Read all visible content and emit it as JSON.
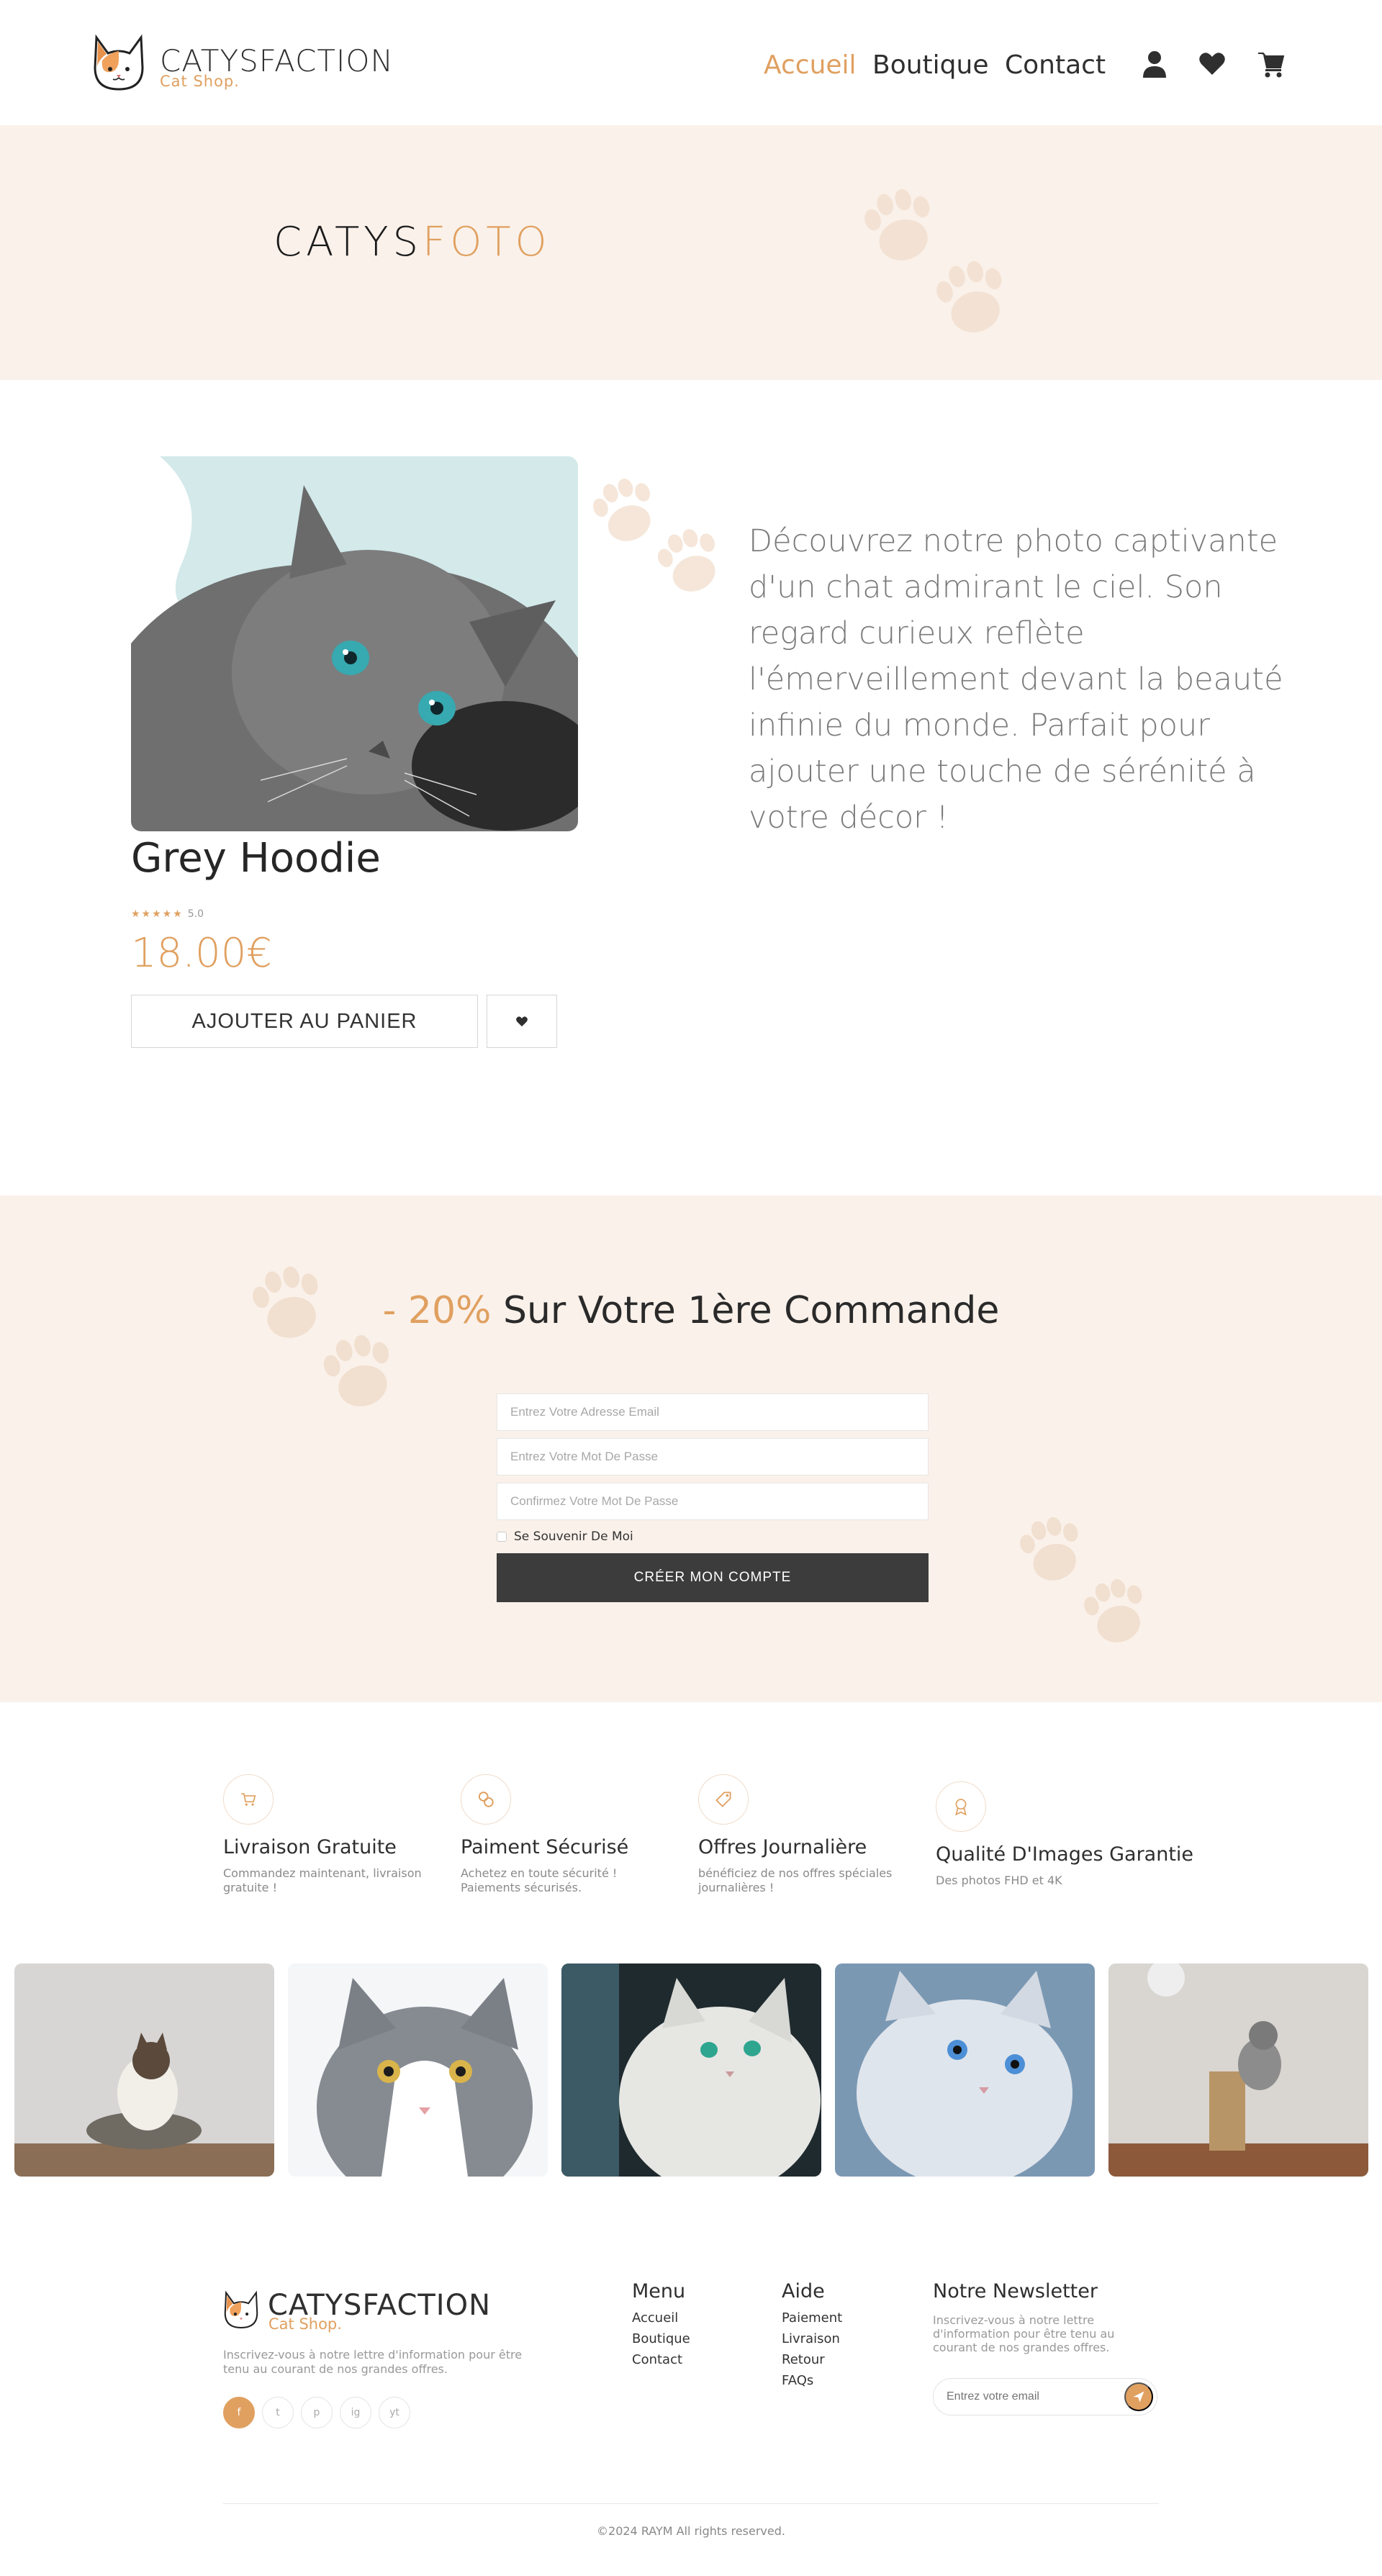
{
  "header": {
    "brand_name": "CATYSFACTION",
    "brand_sub": "Cat Shop.",
    "nav": [
      {
        "label": "Accueil",
        "active": true
      },
      {
        "label": "Boutique",
        "active": false
      },
      {
        "label": "Contact",
        "active": false
      }
    ],
    "icons": [
      "user-icon",
      "heart-icon",
      "cart-icon"
    ]
  },
  "banner": {
    "title_main": "CATYS",
    "title_accent": "FOTO"
  },
  "product": {
    "name": "Grey Hoodie",
    "stars": "★★★★★",
    "rating": "5.0",
    "price": "18.00€",
    "add_to_cart": "AJOUTER AU PANIER",
    "description": "Découvrez notre photo captivante d'un chat admirant le ciel. Son regard curieux reflète l'émerveillement devant la beauté infinie du monde. Parfait pour ajouter une touche de sérénité à votre décor !"
  },
  "promo": {
    "discount": "- 20%",
    "title": "Sur Votre 1ère Commande",
    "email_placeholder": "Entrez Votre Adresse Email",
    "password_placeholder": "Entrez Votre Mot De Passe",
    "confirm_placeholder": "Confirmez Votre Mot De Passe",
    "remember": "Se Souvenir De Moi",
    "create_button": "CRÉER MON COMPTE"
  },
  "features": [
    {
      "title": "Livraison Gratuite",
      "desc": "Commandez maintenant, livraison gratuite !",
      "icon": "cart-icon"
    },
    {
      "title": "Paiment Sécurisé",
      "desc": "Achetez en toute sécurité ! Paiements sécurisés.",
      "icon": "coins-icon"
    },
    {
      "title": "Offres Journalière",
      "desc": "bénéficiez de nos offres spéciales journalières !",
      "icon": "tag-icon"
    },
    {
      "title": "Qualité D'Images Garantie",
      "desc": "Des photos FHD et 4K",
      "icon": "award-icon"
    }
  ],
  "footer": {
    "brand_name": "CATYSFACTION",
    "brand_sub": "Cat Shop.",
    "text": "Inscrivez-vous à notre lettre d'information pour être tenu au courant de nos grandes offres.",
    "social": [
      "f",
      "t",
      "p",
      "ig",
      "yt"
    ],
    "menu_title": "Menu",
    "menu": [
      "Accueil",
      "Boutique",
      "Contact"
    ],
    "help_title": "Aide",
    "help": [
      "Paiement",
      "Livraison",
      "Retour",
      "FAQs"
    ],
    "newsletter_title": "Notre Newsletter",
    "newsletter_text": "Inscrivez-vous à notre lettre d'information pour être tenu au courant de nos grandes offres.",
    "newsletter_placeholder": "Entrez votre email",
    "copyright": "©2024 RAYM All rights reserved."
  },
  "colors": {
    "accent": "#e0a060",
    "banner_bg": "#faf1ea",
    "dark_button": "#3d3c3c"
  }
}
